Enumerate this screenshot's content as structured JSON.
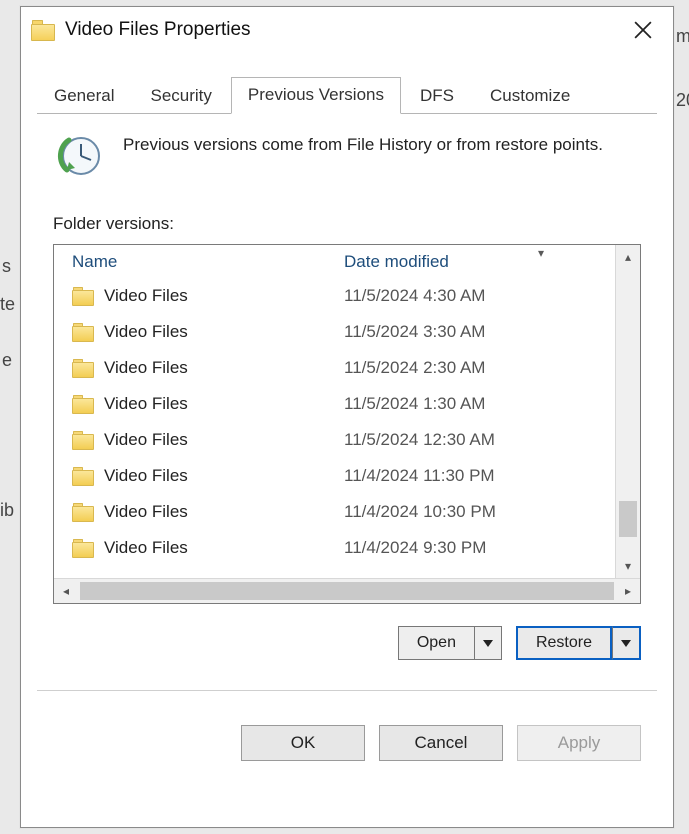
{
  "window": {
    "title": "Video Files Properties"
  },
  "bg": {
    "m": "m",
    "twenty": "20",
    "s": "s",
    "te": "te",
    "e": "e",
    "ib": "ib"
  },
  "tabs": {
    "general": "General",
    "security": "Security",
    "previous_versions": "Previous Versions",
    "dfs": "DFS",
    "customize": "Customize"
  },
  "intro": "Previous versions come from File History or from restore points.",
  "section_label": "Folder versions:",
  "columns": {
    "name": "Name",
    "date": "Date modified"
  },
  "rows": [
    {
      "name": "Video Files",
      "date": "11/5/2024 4:30 AM"
    },
    {
      "name": "Video Files",
      "date": "11/5/2024 3:30 AM"
    },
    {
      "name": "Video Files",
      "date": "11/5/2024 2:30 AM"
    },
    {
      "name": "Video Files",
      "date": "11/5/2024 1:30 AM"
    },
    {
      "name": "Video Files",
      "date": "11/5/2024 12:30 AM"
    },
    {
      "name": "Video Files",
      "date": "11/4/2024 11:30 PM"
    },
    {
      "name": "Video Files",
      "date": "11/4/2024 10:30 PM"
    },
    {
      "name": "Video Files",
      "date": "11/4/2024 9:30 PM"
    }
  ],
  "actions": {
    "open": "Open",
    "restore": "Restore"
  },
  "dialog_buttons": {
    "ok": "OK",
    "cancel": "Cancel",
    "apply": "Apply"
  }
}
